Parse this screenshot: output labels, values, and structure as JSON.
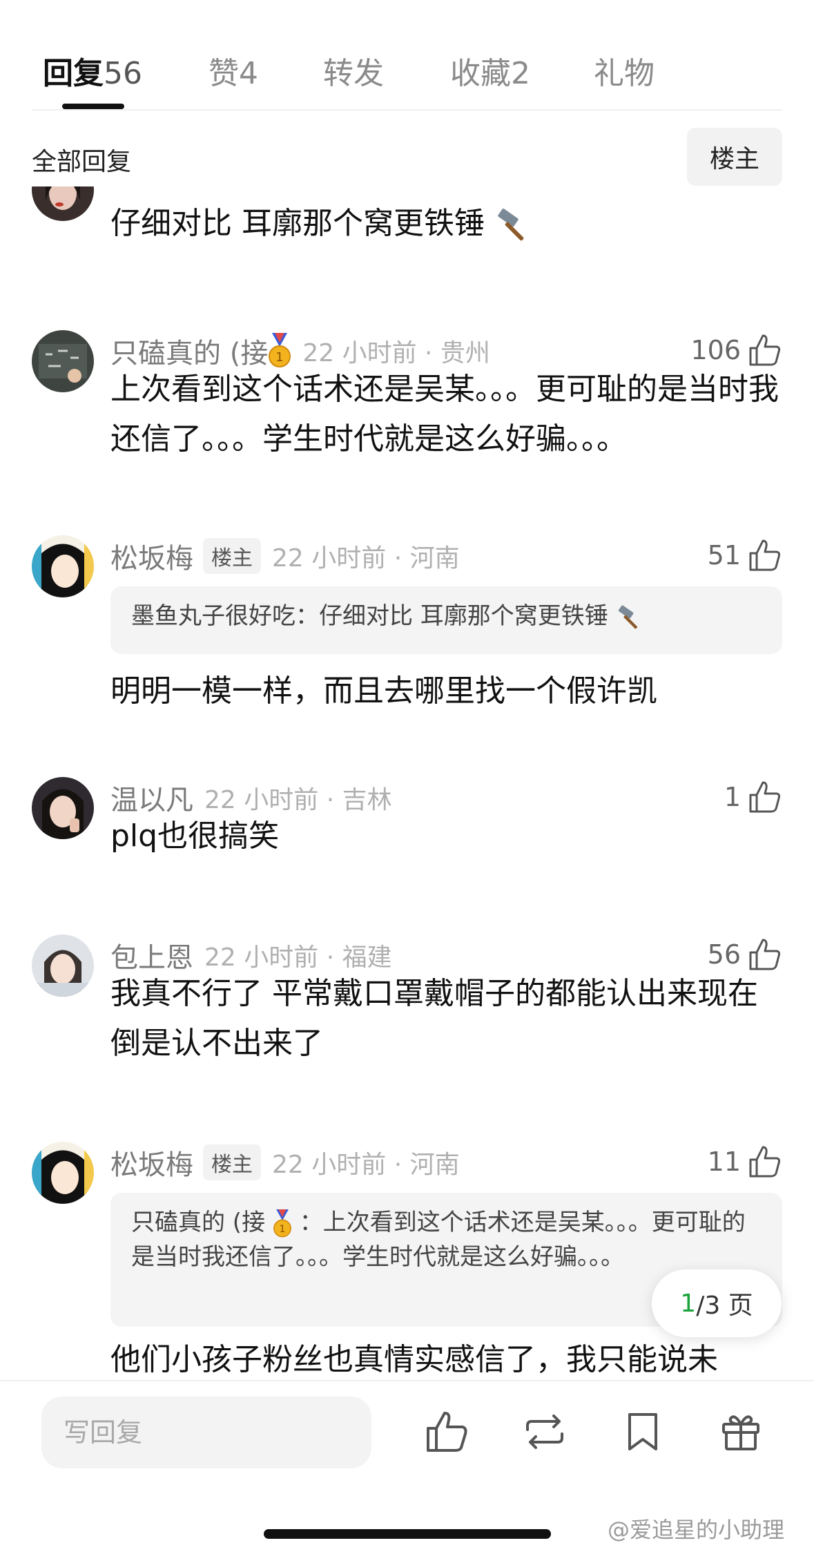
{
  "tabs": [
    {
      "label": "回复",
      "count": "56"
    },
    {
      "label": "赞",
      "count": "4"
    },
    {
      "label": "转发",
      "count": ""
    },
    {
      "label": "收藏",
      "count": "2"
    },
    {
      "label": "礼物",
      "count": ""
    }
  ],
  "subheader": {
    "title": "全部回复",
    "filter_button": "楼主"
  },
  "comments": [
    {
      "text": "仔细对比 耳廓那个窝更铁锤"
    },
    {
      "username": "只磕真的 (接",
      "meta": "22 小时前 · 贵州",
      "likes": "106",
      "text": "上次看到这个话术还是吴某。。。更可耻的是当时我还信了。。。学生时代就是这么好骗。。。"
    },
    {
      "username": "松坂梅",
      "tag": "楼主",
      "meta": "22 小时前 · 河南",
      "likes": "51",
      "quote": "墨鱼丸子很好吃：仔细对比 耳廓那个窝更铁锤",
      "text": "明明一模一样，而且去哪里找一个假许凯"
    },
    {
      "username": "温以凡",
      "meta": "22 小时前 · 吉林",
      "likes": "1",
      "text": "plq也很搞笑"
    },
    {
      "username": "包上恩",
      "meta": "22 小时前 · 福建",
      "likes": "56",
      "text": "我真不行了 平常戴口罩戴帽子的都能认出来现在倒是认不出来了"
    },
    {
      "username": "松坂梅",
      "tag": "楼主",
      "meta": "22 小时前 · 河南",
      "likes": "11",
      "quote_user": "只磕真的 (接",
      "quote": "：上次看到这个话术还是吴某。。。更可耻的是当时我还信了。。。学生时代就是这么好骗。。。",
      "text": "他们小孩子粉丝也真情实感信了，我只能说未"
    }
  ],
  "pagination": {
    "current": "1",
    "total": "/3 页"
  },
  "bottom_bar": {
    "reply_placeholder": "写回复"
  },
  "watermark": "@爱追星的小助理",
  "colors": {
    "accent_green": "#1aa33a",
    "text_primary": "#111111",
    "text_muted": "#7a7a7a",
    "meta": "#b0b0b0"
  }
}
